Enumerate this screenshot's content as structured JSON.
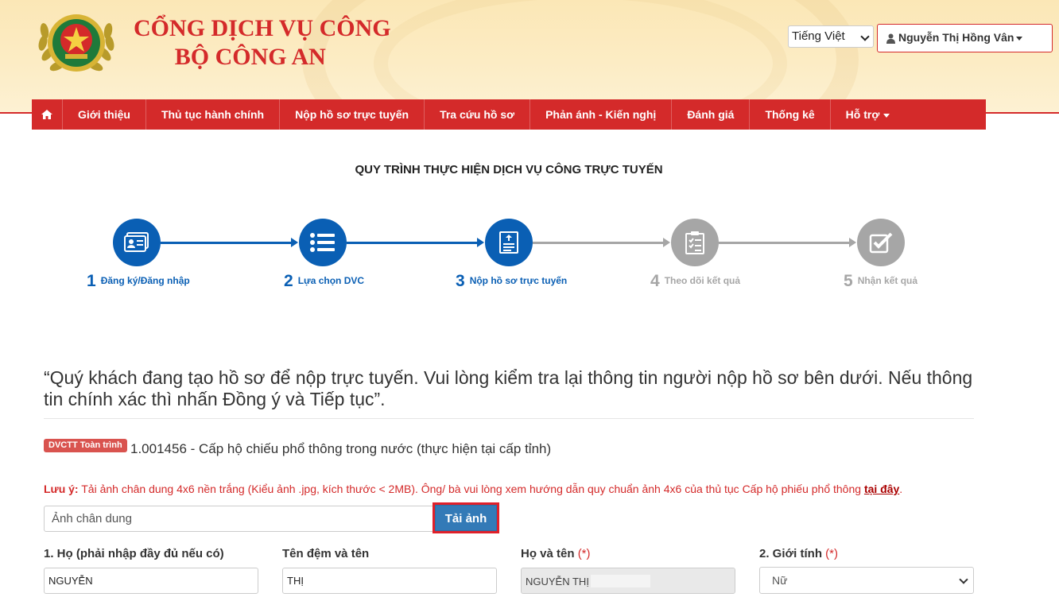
{
  "header": {
    "brand_line1": "CỔNG DỊCH VỤ CÔNG",
    "brand_line2": "BỘ CÔNG AN",
    "language": "Tiếng Việt",
    "user_name": "Nguyễn Thị Hồng Vân"
  },
  "nav": {
    "items": [
      "Giới thiệu",
      "Thủ tục hành chính",
      "Nộp hồ sơ trực tuyến",
      "Tra cứu hồ sơ",
      "Phản ánh - Kiến nghị",
      "Đánh giá",
      "Thống kê",
      "Hỗ trợ"
    ]
  },
  "process": {
    "title": "QUY TRÌNH THỰC HIỆN DỊCH VỤ CÔNG TRỰC TUYẾN",
    "steps": [
      {
        "num": "1",
        "label": "Đăng ký/Đăng nhập",
        "icon": "id-card-icon",
        "active": true
      },
      {
        "num": "2",
        "label": "Lựa chọn DVC",
        "icon": "list-icon",
        "active": true
      },
      {
        "num": "3",
        "label": "Nộp hồ sơ trực tuyến",
        "icon": "document-upload-icon",
        "active": true
      },
      {
        "num": "4",
        "label": "Theo dõi kết quả",
        "icon": "checklist-icon",
        "active": false
      },
      {
        "num": "5",
        "label": "Nhận kết quả",
        "icon": "check-square-icon",
        "active": false
      }
    ],
    "active_color": "#0a5fb4",
    "inactive_color": "#a6a6a6"
  },
  "notice": "“Quý khách đang tạo hồ sơ để nộp trực tuyến. Vui lòng kiểm tra lại thông tin người nộp hồ sơ bên dưới. Nếu thông tin chính xác thì nhấn Đồng ý và Tiếp tục”.",
  "service": {
    "badge": "DVCTT Toàn trình",
    "name": "1.001456 - Cấp hộ chiếu phổ thông trong nước (thực hiện tại cấp tỉnh)"
  },
  "warning": {
    "prefix": "Lưu ý:",
    "text": " Tải ảnh chân dung 4x6 nền trắng (Kiểu ảnh .jpg, kích thước < 2MB). Ông/ bà vui lòng xem hướng dẫn quy chuẩn ảnh 4x6 của thủ tục Cấp hộ phiếu phổ thông ",
    "link": "tại đây",
    "suffix": "."
  },
  "photo": {
    "placeholder": "Ảnh chân dung",
    "button": "Tải ảnh"
  },
  "form": {
    "ho_label": "1. Họ (phải nhập đầy đủ nếu có)",
    "ho_value": "NGUYỄN",
    "ten_label": "Tên đệm và tên",
    "ten_value": "THỊ",
    "hoten_label": "Họ và tên",
    "hoten_value": "NGUYỄN THỊ",
    "gioitinh_label": "2. Giới tính",
    "gioitinh_value": "Nữ",
    "required_mark": "(*)"
  },
  "colors": {
    "brand_red": "#d42a2a",
    "primary_blue": "#337ab7"
  }
}
